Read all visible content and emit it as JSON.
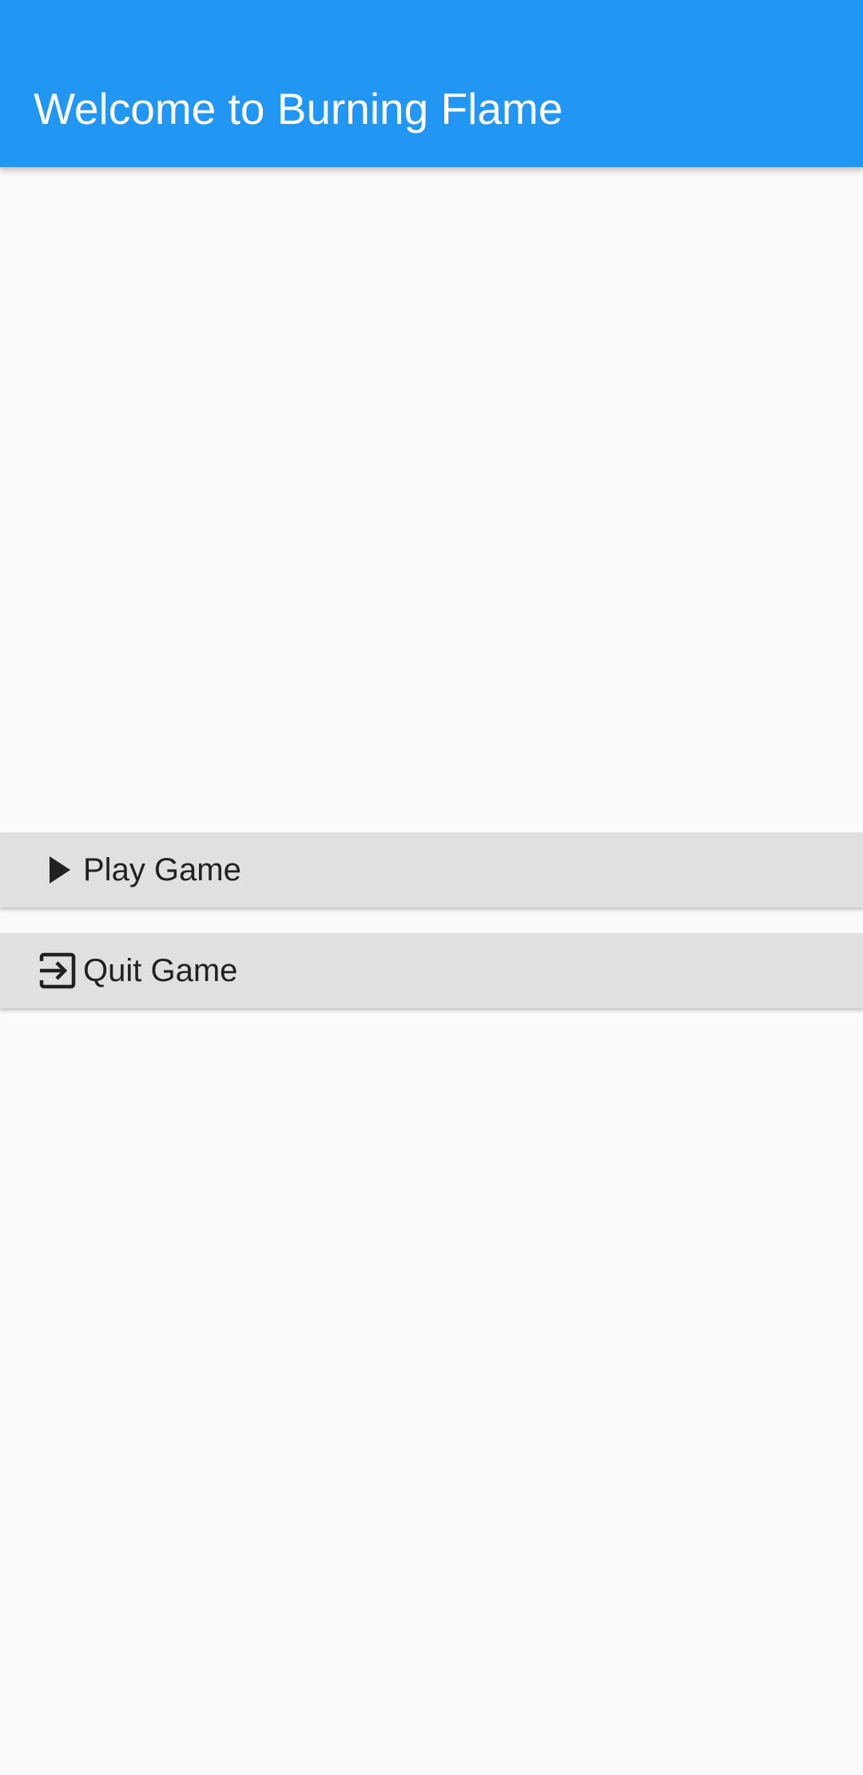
{
  "app_bar": {
    "title": "Welcome to Burning Flame",
    "color": "#2196f3"
  },
  "menu": {
    "buttons": [
      {
        "label": "Play Game",
        "icon": "play-icon"
      },
      {
        "label": "Quit Game",
        "icon": "exit-icon"
      }
    ]
  },
  "colors": {
    "background": "#fafafa",
    "button_background": "#e0e0e0",
    "text": "#212121"
  }
}
